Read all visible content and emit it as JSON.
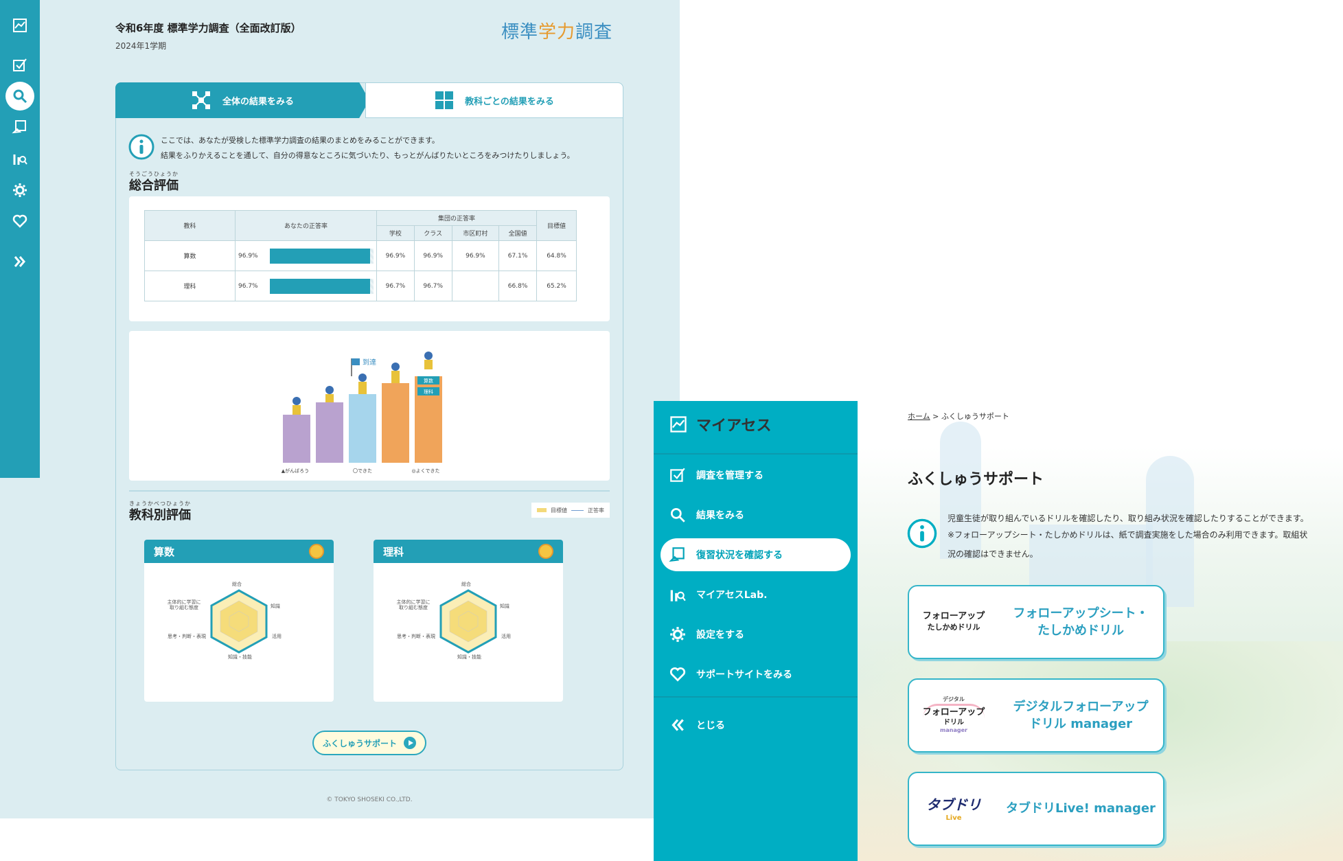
{
  "left_app": {
    "rail": {
      "icons": [
        "chart-icon",
        "checkbox-icon",
        "search-icon",
        "review-icon",
        "lab-icon",
        "gear-icon",
        "heart-icon",
        "expand-icon"
      ],
      "active": "search-icon",
      "accent": "#239fb6"
    },
    "header": {
      "title": "令和6年度 標準学力調査（全面改訂版）",
      "term": "2024年1学期",
      "logo_pre": "標準",
      "logo_accent": "学力",
      "logo_post": "調査"
    },
    "tabs": [
      {
        "label": "全体の結果をみる",
        "active": true
      },
      {
        "label": "教科ごとの結果をみる",
        "active": false
      }
    ],
    "info": {
      "line1": "ここでは、あなたが受検した標準学力調査の結果のまとめをみることができます。",
      "line2": "結果をふりかえることを通して、自分の得意なところに気づいたり、もっとがんばりたいところをみつけたりしましょう。"
    },
    "overall": {
      "ruby": "そうごうひょうか",
      "title": "総合評価",
      "table": {
        "headers": {
          "subject": "教科",
          "your_rate": "あなたの正答率",
          "group": "集団の正答率",
          "group_cols": [
            "学校",
            "クラス",
            "市区町村",
            "全国値"
          ],
          "target": "目標値"
        },
        "rows": [
          {
            "subject": "算数",
            "your": "96.9%",
            "your_value": 96.9,
            "school": "96.9%",
            "class": "96.9%",
            "city": "96.9%",
            "national": "67.1%",
            "target": "64.8%"
          },
          {
            "subject": "理科",
            "your": "96.7%",
            "your_value": 96.7,
            "school": "96.7%",
            "class": "96.7%",
            "city": "",
            "national": "66.8%",
            "target": "65.2%"
          }
        ]
      },
      "illustration": {
        "flag": "到達",
        "tags": [
          "算数",
          "理科"
        ],
        "levels": [
          "▲がんばろう",
          "〇できた",
          "◎よくできた"
        ]
      }
    },
    "by_subject": {
      "ruby": "きょうかべつひょうか",
      "title": "教科別評価",
      "legend": {
        "target": "目標値",
        "rate": "正答率"
      },
      "cards": [
        {
          "name": "算数",
          "axes": [
            "総合",
            "知識",
            "活用",
            "知識・技能",
            "思考・判断・表現",
            "主体的に学習に取り組む態度"
          ]
        },
        {
          "name": "理科",
          "axes": [
            "総合",
            "知識",
            "活用",
            "知識・技能",
            "思考・判断・表現",
            "主体的に学習に取り組む態度"
          ]
        }
      ]
    },
    "review_button": "ふくしゅうサポート",
    "copyright": "© TOKYO SHOSEKI CO.,LTD."
  },
  "right_app": {
    "brand": "マイアセス",
    "menu": [
      {
        "label": "調査を管理する",
        "icon": "checkbox-icon",
        "active": false
      },
      {
        "label": "結果をみる",
        "icon": "search-icon",
        "active": false
      },
      {
        "label": "復習状況を確認する",
        "icon": "review-icon",
        "active": true
      },
      {
        "label": "マイアセスLab.",
        "icon": "lab-icon",
        "active": false
      },
      {
        "label": "設定をする",
        "icon": "gear-icon",
        "active": false
      },
      {
        "label": "サポートサイトをみる",
        "icon": "heart-icon",
        "active": false
      }
    ],
    "close_label": "とじる",
    "breadcrumb": {
      "home": "ホーム",
      "sep": ">",
      "current": "ふくしゅうサポート"
    },
    "title": "ふくしゅうサポート",
    "info": {
      "line1": "児童生徒が取り組んでいるドリルを確認したり、取り組み状況を確認したりすることができます。",
      "line2": "※フォローアップシート・たしかめドリルは、紙で調査実施をした場合のみ利用できます。取組状",
      "line3": "況の確認はできません。"
    },
    "links": [
      {
        "logo_l1": "フォローアップ",
        "logo_l2": "たしかめドリル",
        "label_l1": "フォローアップシート・",
        "label_l2": "たしかめドリル"
      },
      {
        "logo_l1": "フォローアップ",
        "logo_l2": "ドリル",
        "logo_small": "デジタル",
        "logo_sub": "manager",
        "label_l1": "デジタルフォローアップ",
        "label_l2": "ドリル manager"
      },
      {
        "logo_l1": "タブドリ",
        "logo_l2": "Live",
        "label_l1": "タブドリLive! manager",
        "label_l2": ""
      }
    ],
    "accent": "#00aec3"
  }
}
